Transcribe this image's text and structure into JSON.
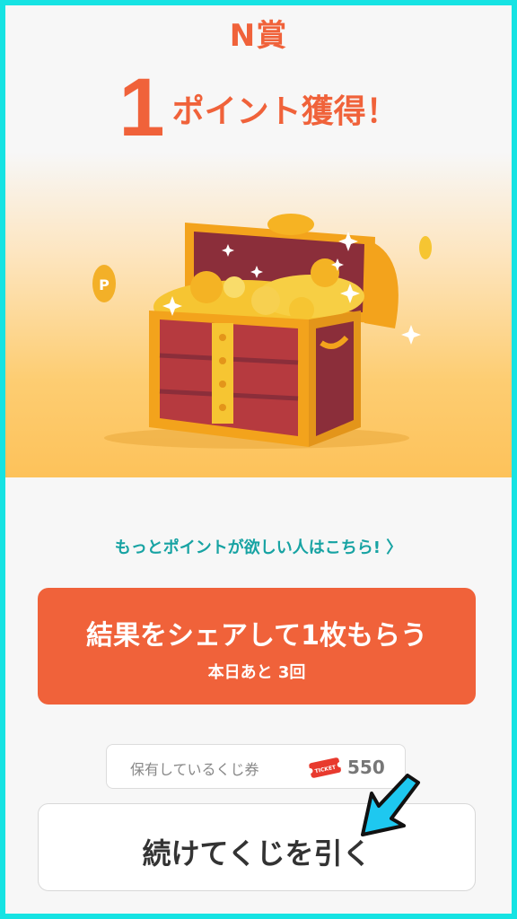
{
  "prize": {
    "title": "N賞",
    "points_number": "1",
    "points_label": "ポイント獲得！"
  },
  "hero": {
    "image": "treasure-chest-with-coins",
    "coin_letter": "P"
  },
  "more_points_link": "もっとポイントが欲しい人はこちら! 〉",
  "share_button": {
    "label": "結果をシェアして1枚もらう",
    "sub_label": "本日あと 3回"
  },
  "tickets": {
    "label": "保有しているくじ券",
    "icon": "ticket-icon",
    "icon_text": "TICKET",
    "count": "550"
  },
  "continue_button": {
    "label": "続けてくじを引く"
  },
  "colors": {
    "accent": "#f0623a",
    "link": "#17a3a3",
    "frame": "#16e3e3",
    "pointer": "#1ec8f0"
  }
}
